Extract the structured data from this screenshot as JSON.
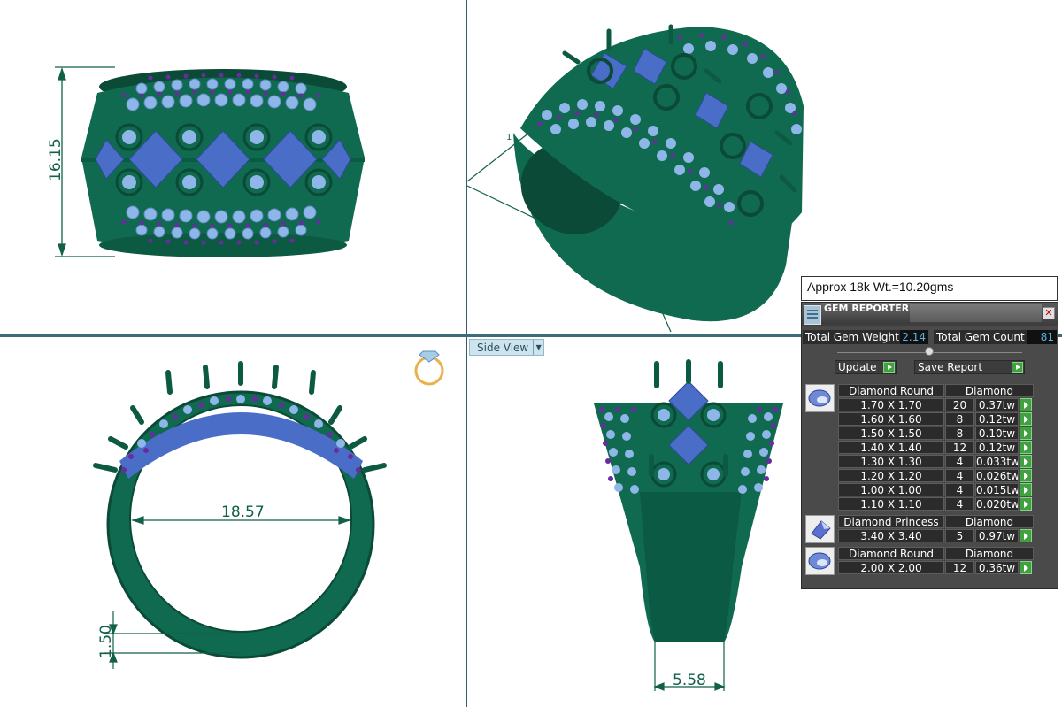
{
  "dimensions": {
    "height": "16.15",
    "inner_diameter": "18.57",
    "shank_thickness": "1.50",
    "shank_width": "5.58"
  },
  "view_label": "Side View",
  "weight_note": "Approx 18k Wt.=10.20gms",
  "gem_reporter": {
    "title": "GEM REPORTER",
    "total_gem_weight_label": "Total Gem Weight",
    "total_gem_weight": "2.14",
    "total_gem_count_label": "Total Gem Count",
    "total_gem_count": "81",
    "update_label": "Update",
    "save_report_label": "Save Report",
    "groups": [
      {
        "shape": "Diamond Round",
        "material": "Diamond",
        "icon": "round-gem-icon",
        "rows": [
          {
            "size": "1.70 X 1.70",
            "count": "20",
            "weight": "0.37tw"
          },
          {
            "size": "1.60 X 1.60",
            "count": "8",
            "weight": "0.12tw"
          },
          {
            "size": "1.50 X 1.50",
            "count": "8",
            "weight": "0.10tw"
          },
          {
            "size": "1.40 X 1.40",
            "count": "12",
            "weight": "0.12tw"
          },
          {
            "size": "1.30 X 1.30",
            "count": "4",
            "weight": "0.033tw"
          },
          {
            "size": "1.20 X 1.20",
            "count": "4",
            "weight": "0.026tw"
          },
          {
            "size": "1.00 X 1.00",
            "count": "4",
            "weight": "0.015tw"
          },
          {
            "size": "1.10 X 1.10",
            "count": "4",
            "weight": "0.020tw"
          }
        ]
      },
      {
        "shape": "Diamond Princess",
        "material": "Diamond",
        "icon": "princess-gem-icon",
        "rows": [
          {
            "size": "3.40 X 3.40",
            "count": "5",
            "weight": "0.97tw"
          }
        ]
      },
      {
        "shape": "Diamond Round",
        "material": "Diamond",
        "icon": "round-gem-icon",
        "rows": [
          {
            "size": "2.00 X 2.00",
            "count": "12",
            "weight": "0.36tw"
          }
        ]
      }
    ]
  },
  "colors": {
    "metal": "#106a50",
    "metal_dark": "#0a4a36",
    "dimension": "#12604a",
    "gem_blue": "#8fb6e8",
    "princess_blue": "#4a6ec8",
    "accent_purple": "#6a2aa0",
    "divider": "#2f5f6b",
    "panel_bg": "#4a4a4a",
    "value_blue": "#59b7e8",
    "go_green": "#3fa23f"
  }
}
